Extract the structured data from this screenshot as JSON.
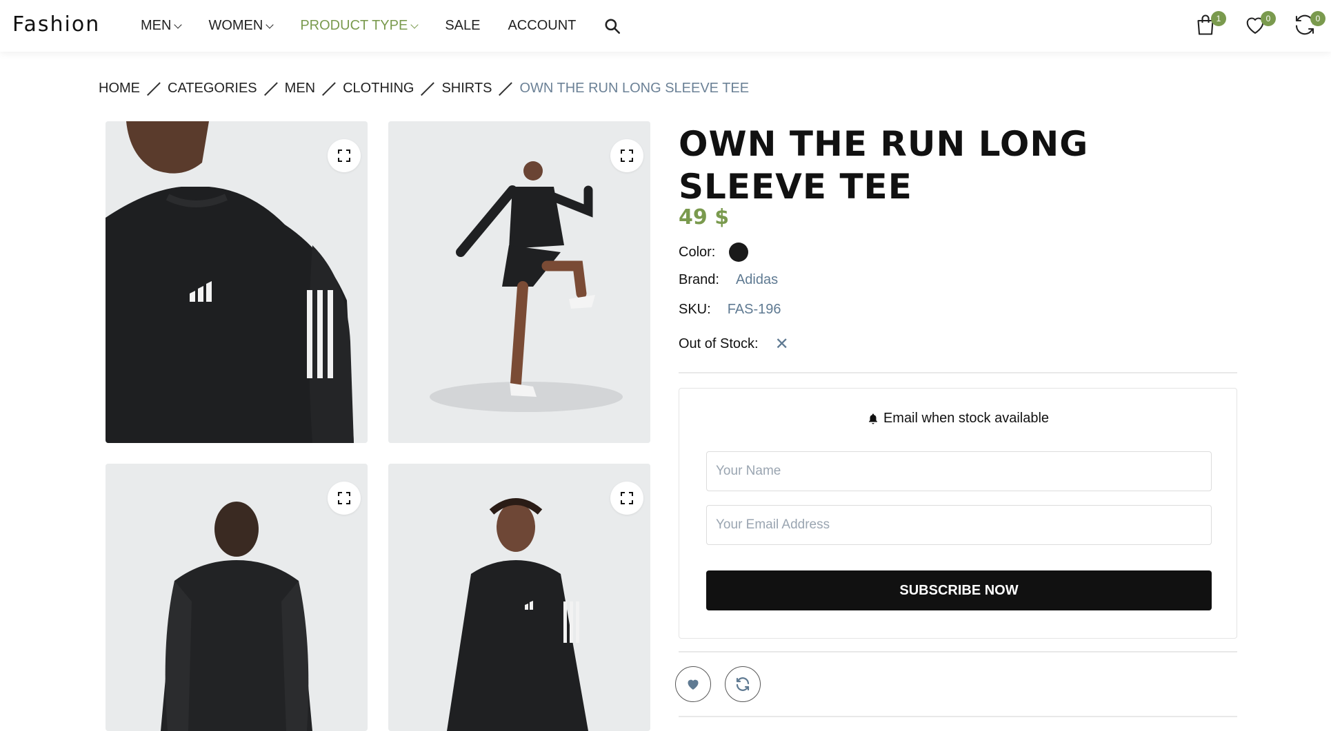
{
  "header": {
    "logo": "Fashion",
    "nav": [
      {
        "label": "MEN",
        "has_dropdown": true,
        "active": false
      },
      {
        "label": "WOMEN",
        "has_dropdown": true,
        "active": false
      },
      {
        "label": "PRODUCT TYPE",
        "has_dropdown": true,
        "active": true
      },
      {
        "label": "SALE",
        "has_dropdown": false,
        "active": false
      },
      {
        "label": "ACCOUNT",
        "has_dropdown": false,
        "active": false
      }
    ],
    "search_icon": "search-icon",
    "cart_count": "1",
    "wishlist_count": "0",
    "compare_count": "0"
  },
  "breadcrumb": {
    "items": [
      "HOME",
      "CATEGORIES",
      "MEN",
      "CLOTHING",
      "SHIRTS"
    ],
    "current": "OWN THE RUN LONG SLEEVE TEE"
  },
  "product": {
    "title": "OWN THE RUN LONG SLEEVE TEE",
    "price": "49 $",
    "color_label": "Color:",
    "color_value": "#1a1a1a",
    "brand_label": "Brand:",
    "brand": "Adidas",
    "sku_label": "SKU:",
    "sku": "FAS-196",
    "stock_label": "Out of Stock:",
    "stock_icon": "✕"
  },
  "notify": {
    "title": "Email when stock available",
    "name_placeholder": "Your Name",
    "email_placeholder": "Your Email Address",
    "button": "SUBSCRIBE NOW"
  },
  "colors": {
    "accent": "#7a9a4e",
    "muted_link": "#5f7a92",
    "button_bg": "#111111"
  }
}
